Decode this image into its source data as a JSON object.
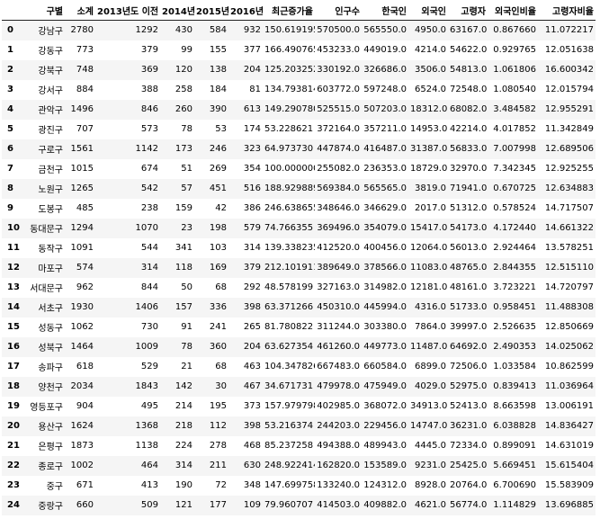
{
  "table": {
    "columns": [
      "",
      "구별",
      "소계",
      "2013년도 이전",
      "2014년",
      "2015년",
      "2016년",
      "최근증가율",
      "인구수",
      "한국인",
      "외국인",
      "고령자",
      "외국인비율",
      "고령자비율"
    ],
    "rows": [
      [
        "0",
        "강남구",
        "2780",
        "1292",
        "430",
        "584",
        "932",
        "150.619195",
        "570500.0",
        "565550.0",
        "4950.0",
        "63167.0",
        "0.867660",
        "11.072217"
      ],
      [
        "1",
        "강동구",
        "773",
        "379",
        "99",
        "155",
        "377",
        "166.490765",
        "453233.0",
        "449019.0",
        "4214.0",
        "54622.0",
        "0.929765",
        "12.051638"
      ],
      [
        "2",
        "강북구",
        "748",
        "369",
        "120",
        "138",
        "204",
        "125.203252",
        "330192.0",
        "326686.0",
        "3506.0",
        "54813.0",
        "1.061806",
        "16.600342"
      ],
      [
        "3",
        "강서구",
        "884",
        "388",
        "258",
        "184",
        "81",
        "134.793814",
        "603772.0",
        "597248.0",
        "6524.0",
        "72548.0",
        "1.080540",
        "12.015794"
      ],
      [
        "4",
        "관악구",
        "1496",
        "846",
        "260",
        "390",
        "613",
        "149.290780",
        "525515.0",
        "507203.0",
        "18312.0",
        "68082.0",
        "3.484582",
        "12.955291"
      ],
      [
        "5",
        "광진구",
        "707",
        "573",
        "78",
        "53",
        "174",
        "53.228621",
        "372164.0",
        "357211.0",
        "14953.0",
        "42214.0",
        "4.017852",
        "11.342849"
      ],
      [
        "6",
        "구로구",
        "1561",
        "1142",
        "173",
        "246",
        "323",
        "64.973730",
        "447874.0",
        "416487.0",
        "31387.0",
        "56833.0",
        "7.007998",
        "12.689506"
      ],
      [
        "7",
        "금천구",
        "1015",
        "674",
        "51",
        "269",
        "354",
        "100.000000",
        "255082.0",
        "236353.0",
        "18729.0",
        "32970.0",
        "7.342345",
        "12.925255"
      ],
      [
        "8",
        "노원구",
        "1265",
        "542",
        "57",
        "451",
        "516",
        "188.929889",
        "569384.0",
        "565565.0",
        "3819.0",
        "71941.0",
        "0.670725",
        "12.634883"
      ],
      [
        "9",
        "도봉구",
        "485",
        "238",
        "159",
        "42",
        "386",
        "246.638655",
        "348646.0",
        "346629.0",
        "2017.0",
        "51312.0",
        "0.578524",
        "14.717507"
      ],
      [
        "10",
        "동대문구",
        "1294",
        "1070",
        "23",
        "198",
        "579",
        "74.766355",
        "369496.0",
        "354079.0",
        "15417.0",
        "54173.0",
        "4.172440",
        "14.661322"
      ],
      [
        "11",
        "동작구",
        "1091",
        "544",
        "341",
        "103",
        "314",
        "139.338235",
        "412520.0",
        "400456.0",
        "12064.0",
        "56013.0",
        "2.924464",
        "13.578251"
      ],
      [
        "12",
        "마포구",
        "574",
        "314",
        "118",
        "169",
        "379",
        "212.101911",
        "389649.0",
        "378566.0",
        "11083.0",
        "48765.0",
        "2.844355",
        "12.515110"
      ],
      [
        "13",
        "서대문구",
        "962",
        "844",
        "50",
        "68",
        "292",
        "48.578199",
        "327163.0",
        "314982.0",
        "12181.0",
        "48161.0",
        "3.723221",
        "14.720797"
      ],
      [
        "14",
        "서초구",
        "1930",
        "1406",
        "157",
        "336",
        "398",
        "63.371266",
        "450310.0",
        "445994.0",
        "4316.0",
        "51733.0",
        "0.958451",
        "11.488308"
      ],
      [
        "15",
        "성동구",
        "1062",
        "730",
        "91",
        "241",
        "265",
        "81.780822",
        "311244.0",
        "303380.0",
        "7864.0",
        "39997.0",
        "2.526635",
        "12.850669"
      ],
      [
        "16",
        "성북구",
        "1464",
        "1009",
        "78",
        "360",
        "204",
        "63.627354",
        "461260.0",
        "449773.0",
        "11487.0",
        "64692.0",
        "2.490353",
        "14.025062"
      ],
      [
        "17",
        "송파구",
        "618",
        "529",
        "21",
        "68",
        "463",
        "104.347826",
        "667483.0",
        "660584.0",
        "6899.0",
        "72506.0",
        "1.033584",
        "10.862599"
      ],
      [
        "18",
        "양천구",
        "2034",
        "1843",
        "142",
        "30",
        "467",
        "34.671731",
        "479978.0",
        "475949.0",
        "4029.0",
        "52975.0",
        "0.839413",
        "11.036964"
      ],
      [
        "19",
        "영등포구",
        "904",
        "495",
        "214",
        "195",
        "373",
        "157.979798",
        "402985.0",
        "368072.0",
        "34913.0",
        "52413.0",
        "8.663598",
        "13.006191"
      ],
      [
        "20",
        "용산구",
        "1624",
        "1368",
        "218",
        "112",
        "398",
        "53.216374",
        "244203.0",
        "229456.0",
        "14747.0",
        "36231.0",
        "6.038828",
        "14.836427"
      ],
      [
        "21",
        "은평구",
        "1873",
        "1138",
        "224",
        "278",
        "468",
        "85.237258",
        "494388.0",
        "489943.0",
        "4445.0",
        "72334.0",
        "0.899091",
        "14.631019"
      ],
      [
        "22",
        "종로구",
        "1002",
        "464",
        "314",
        "211",
        "630",
        "248.922414",
        "162820.0",
        "153589.0",
        "9231.0",
        "25425.0",
        "5.669451",
        "15.615404"
      ],
      [
        "23",
        "중구",
        "671",
        "413",
        "190",
        "72",
        "348",
        "147.699758",
        "133240.0",
        "124312.0",
        "8928.0",
        "20764.0",
        "6.700690",
        "15.583909"
      ],
      [
        "24",
        "중랑구",
        "660",
        "509",
        "121",
        "177",
        "109",
        "79.960707",
        "414503.0",
        "409882.0",
        "4621.0",
        "56774.0",
        "1.114829",
        "13.696885"
      ]
    ]
  }
}
